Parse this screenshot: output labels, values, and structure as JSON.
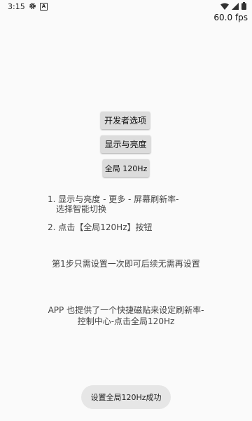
{
  "status_bar": {
    "time": "3:15",
    "icons": [
      "gear-icon",
      "a-badge-icon",
      "wifi-icon",
      "signal-icon",
      "battery-icon"
    ],
    "fps_label": "60.0 fps"
  },
  "buttons": {
    "developer_options": "开发者选项",
    "display_brightness": "显示与亮度",
    "global_120hz": "全局 120Hz"
  },
  "instructions": {
    "step1_line1": "1. 显示与亮度 - 更多 - 屏幕刷新率-",
    "step1_line2": "选择智能切换",
    "step2": "2. 点击【全局120Hz】按钮"
  },
  "note": "第1步只需设置一次即可后续无需再设置",
  "app_info": {
    "line1": "APP 也提供了一个快捷磁贴来设定刷新率-",
    "line2": "控制中心-点击全局120Hz"
  },
  "toast": "设置全局120Hz成功",
  "colors": {
    "background": "#fafafa",
    "button": "#dcdcdc",
    "toast": "#e6e6e6"
  }
}
